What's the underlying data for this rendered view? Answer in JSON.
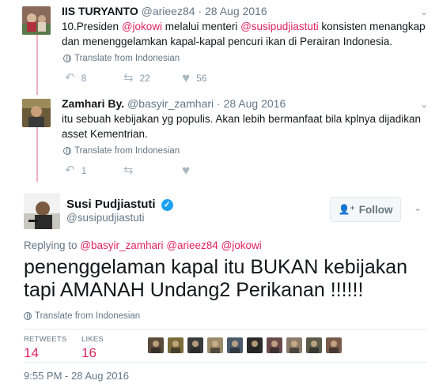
{
  "tweets": [
    {
      "name": "IIS TURYANTO",
      "handle": "@arieez84",
      "date": "28 Aug 2016",
      "text_parts": {
        "p1": "10.Presiden ",
        "m1": "@jokowi",
        "p2": " melalui menteri ",
        "m2": "@susipudjiastuti",
        "p3": " konsisten menangkap dan menenggelamkan kapal-kapal pencuri ikan di Perairan Indonesia."
      },
      "translate": "Translate from Indonesian",
      "replies": "8",
      "retweets": "22",
      "likes": "56"
    },
    {
      "name": "Zamhari By.",
      "handle": "@basyir_zamhari",
      "date": "28 Aug 2016",
      "text": "itu sebuah kebijakan yg populis. Akan lebih bermanfaat bila kplnya dijadikan asset Kementrian.",
      "translate": "Translate from Indonesian",
      "replies": "1",
      "retweets": "",
      "likes": ""
    }
  ],
  "main": {
    "name": "Susi Pudjiastuti",
    "handle": "@susipudjiastuti",
    "follow_label": "Follow",
    "replying_prefix": "Replying to ",
    "replying_mentions": [
      "@basyir_zamhari",
      "@arieez84",
      "@jokowi"
    ],
    "text": "penenggelaman kapal itu BUKAN kebijakan tapi AMANAH Undang2 Perikanan !!!!!!",
    "translate": "Translate from Indonesian",
    "retweets_label": "RETWEETS",
    "retweets_value": "14",
    "likes_label": "LIKES",
    "likes_value": "16",
    "timestamp": "9:55 PM - 28 Aug 2016"
  },
  "separator": "·",
  "icons": {
    "reply": "reply-icon",
    "retweet": "retweet-icon",
    "like": "heart-icon",
    "verified": "verified-badge-icon",
    "translate": "globe-icon",
    "more": "chevron-down-icon",
    "follow": "add-user-icon"
  },
  "colors": {
    "accent": "#e0245e",
    "verified": "#1da1f2",
    "muted": "#657786"
  },
  "liker_colors": [
    "#5a4a3a",
    "#7a6b3a",
    "#3a3a3a",
    "#9a8a6a",
    "#4a5a6a",
    "#2a2a2a",
    "#6a4a4a",
    "#8a7a6a",
    "#5a5a4a",
    "#7a5a4a"
  ]
}
